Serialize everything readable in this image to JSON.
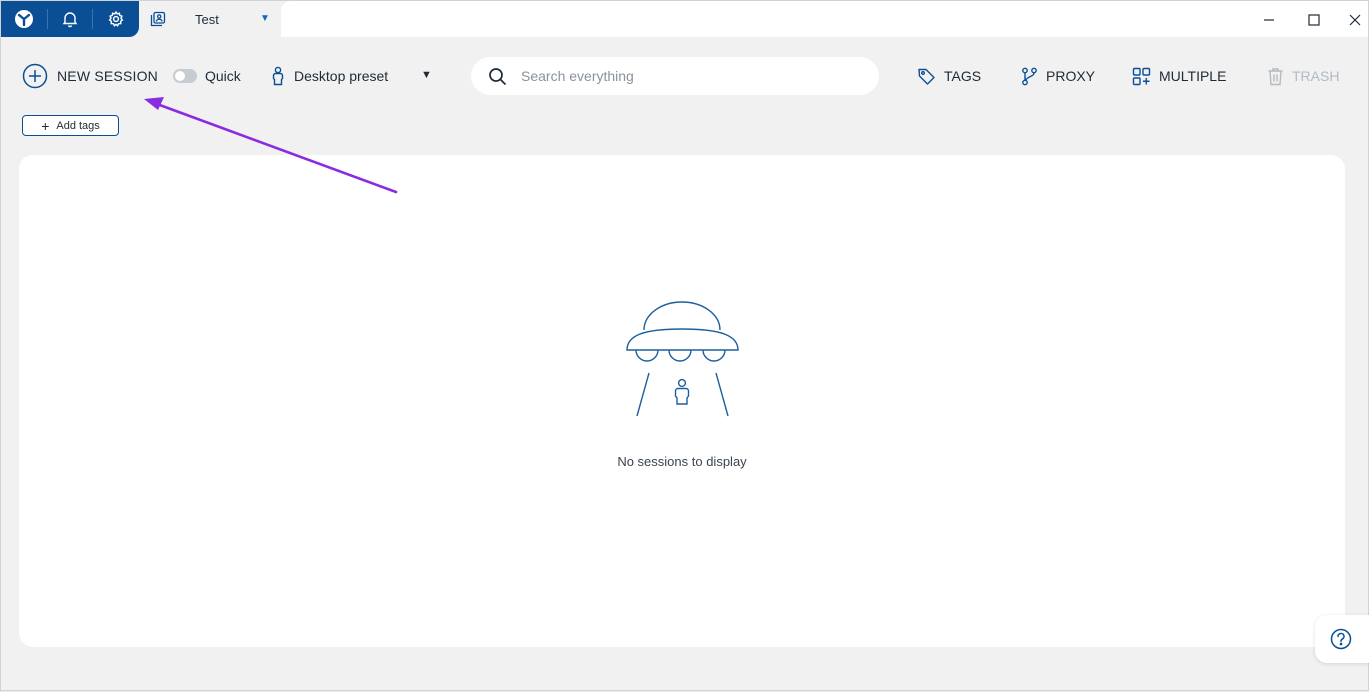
{
  "tabbar": {
    "tab_title": "Test"
  },
  "toolbar": {
    "new_session_label": "NEW SESSION",
    "quick_label": "Quick",
    "quick_enabled": false,
    "preset_label": "Desktop preset",
    "tags_label": "TAGS",
    "proxy_label": "PROXY",
    "multiple_label": "MULTIPLE",
    "trash_label": "TRASH"
  },
  "search": {
    "placeholder": "Search everything",
    "value": ""
  },
  "add_tags_label": "Add tags",
  "main": {
    "empty_message": "No sessions to display"
  },
  "colors": {
    "brand_blue": "#0a4f96",
    "annotation_arrow": "#8a2be2",
    "disabled_gray": "#b3bac2"
  }
}
